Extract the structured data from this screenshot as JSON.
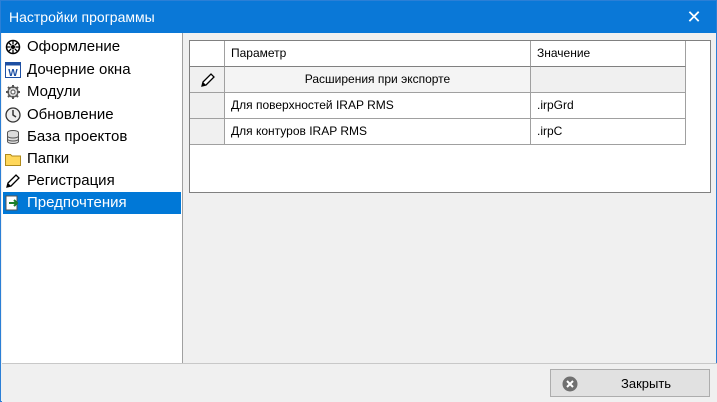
{
  "window": {
    "title": "Настройки программы",
    "close_glyph": "✕"
  },
  "sidebar": {
    "items": [
      {
        "label": "Оформление",
        "icon": "palette-gear-icon"
      },
      {
        "label": "Дочерние окна",
        "icon": "word-window-icon"
      },
      {
        "label": "Модули",
        "icon": "gear-icon"
      },
      {
        "label": "Обновление",
        "icon": "clock-icon"
      },
      {
        "label": "База проектов",
        "icon": "database-icon"
      },
      {
        "label": "Папки",
        "icon": "folder-icon"
      },
      {
        "label": "Регистрация",
        "icon": "pencil-icon"
      },
      {
        "label": "Предпочтения",
        "icon": "arrow-page-icon",
        "selected": true
      }
    ]
  },
  "grid": {
    "headers": {
      "param": "Параметр",
      "value": "Значение"
    },
    "group_label": "Расширения при экспорте",
    "rows": [
      {
        "param": "Для поверхностей IRAP RMS",
        "value": ".irpGrd"
      },
      {
        "param": "Для контуров IRAP RMS",
        "value": ".irpC"
      }
    ]
  },
  "footer": {
    "close_label": "Закрыть"
  },
  "colors": {
    "accent": "#0078d7",
    "titlebar": "#0a78d7"
  }
}
